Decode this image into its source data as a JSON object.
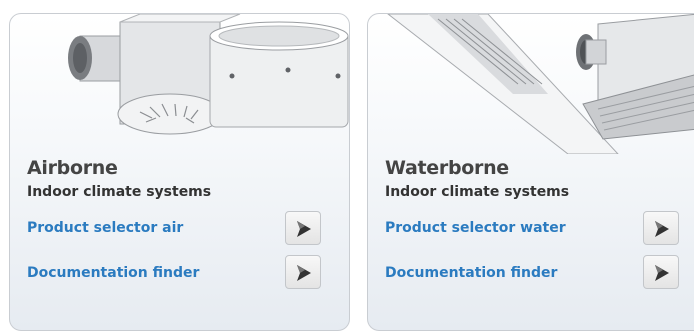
{
  "cards": [
    {
      "title": "Airborne",
      "subtitle": "Indoor climate systems",
      "links": [
        "Product selector air",
        "Documentation finder"
      ]
    },
    {
      "title": "Waterborne",
      "subtitle": "Indoor climate systems",
      "links": [
        "Product selector water",
        "Documentation finder"
      ]
    }
  ],
  "icons": {
    "arrow": "arrow-right-icon",
    "product_image_air": "air-diffuser-image",
    "product_image_water": "ceiling-cassette-image"
  },
  "colors": {
    "link": "#2b7bc0",
    "title": "#444444",
    "card_border": "#c9cdd2"
  }
}
